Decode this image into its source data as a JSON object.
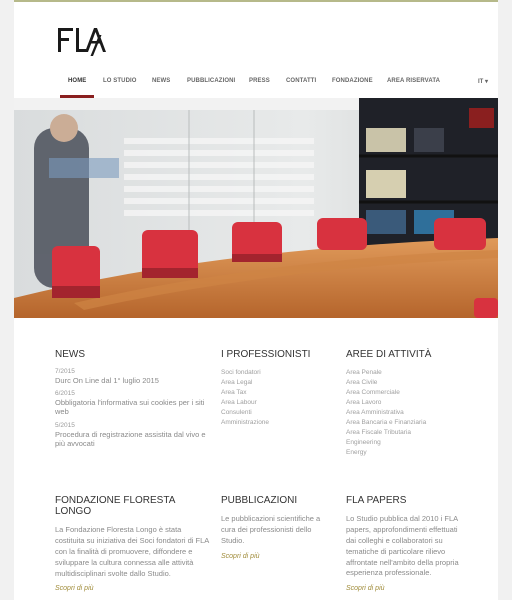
{
  "brand": {
    "logo_text": "FLA"
  },
  "nav": {
    "items": [
      {
        "label": "HOME"
      },
      {
        "label": "LO STUDIO"
      },
      {
        "label": "NEWS"
      },
      {
        "label": "PUBBLICAZIONI"
      },
      {
        "label": "PRESS"
      },
      {
        "label": "CONTATTI"
      },
      {
        "label": "FONDAZIONE"
      },
      {
        "label": "AREA RISERVATA"
      }
    ],
    "language": "IT ▾"
  },
  "news": {
    "title": "NEWS",
    "items": [
      {
        "date": "7/2015",
        "text": "Durc On Line dal 1° luglio 2015"
      },
      {
        "date": "6/2015",
        "text": "Obbligatoria l'informativa sui cookies per i siti web"
      },
      {
        "date": "5/2015",
        "text": "Procedura di registrazione assistita dal vivo e più avvocati"
      }
    ]
  },
  "professionisti": {
    "title": "I PROFESSIONISTI",
    "items": [
      "Soci fondatori",
      "Area Legal",
      "Area Tax",
      "Area Labour",
      "Consulenti",
      "Amministrazione"
    ]
  },
  "aree": {
    "title": "AREE DI ATTIVITÀ",
    "items": [
      "Area Penale",
      "Area Civile",
      "Area Commerciale",
      "Area Lavoro",
      "Area Amministrativa",
      "Area Bancaria e Finanziaria",
      "Area Fiscale Tributaria",
      "Engineering",
      "Energy"
    ]
  },
  "fondazione": {
    "title": "FONDAZIONE FLORESTA LONGO",
    "text": "La Fondazione Floresta Longo è stata costituita su iniziativa dei Soci fondatori di FLA con la finalità di promuovere, diffondere e sviluppare la cultura connessa alle attività multidisciplinari svolte dallo Studio.",
    "more": "Scopri di più"
  },
  "pubblicazioni": {
    "title": "PUBBLICAZIONI",
    "text": "Le pubblicazioni scientifiche a cura dei professionisti dello Studio.",
    "more": "Scopri di più"
  },
  "papers": {
    "title": "FLA PAPERS",
    "text": "Lo Studio pubblica dal 2010 i FLA papers, approfondimenti effettuati dai colleghi e collaboratori su tematiche di particolare rilievo affrontate nell'ambito della propria esperienza professionale.",
    "more": "Scopri di più"
  }
}
